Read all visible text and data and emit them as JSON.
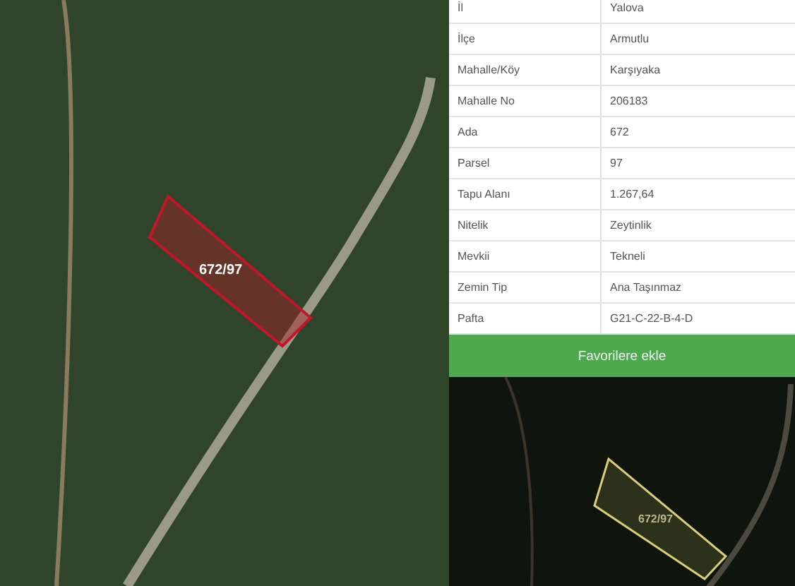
{
  "main_map": {
    "parcel_label": "672/97"
  },
  "details": [
    {
      "label": "İl",
      "value": "Yalova"
    },
    {
      "label": "İlçe",
      "value": "Armutlu"
    },
    {
      "label": "Mahalle/Köy",
      "value": "Karşıyaka"
    },
    {
      "label": "Mahalle No",
      "value": "206183"
    },
    {
      "label": "Ada",
      "value": "672"
    },
    {
      "label": "Parsel",
      "value": "97"
    },
    {
      "label": "Tapu Alanı",
      "value": "1.267,64"
    },
    {
      "label": "Nitelik",
      "value": "Zeytinlik"
    },
    {
      "label": "Mevkii",
      "value": "Tekneli"
    },
    {
      "label": "Zemin Tip",
      "value": "Ana Taşınmaz"
    },
    {
      "label": "Pafta",
      "value": "G21-C-22-B-4-D"
    }
  ],
  "favorite_button": "Favorilere ekle",
  "preview_map": {
    "parcel_label": "672/97"
  }
}
